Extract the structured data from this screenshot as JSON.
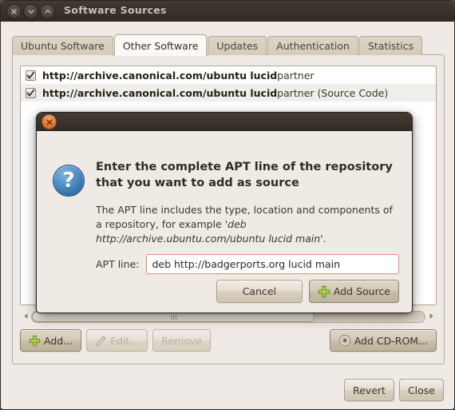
{
  "window": {
    "title": "Software Sources",
    "controls": [
      {
        "name": "close",
        "glyph": "×"
      },
      {
        "name": "minimize",
        "glyph": "∨"
      },
      {
        "name": "maximize",
        "glyph": "∧"
      }
    ]
  },
  "tabs": [
    {
      "label": "Ubuntu Software",
      "active": false
    },
    {
      "label": "Other Software",
      "active": true
    },
    {
      "label": "Updates",
      "active": false
    },
    {
      "label": "Authentication",
      "active": false
    },
    {
      "label": "Statistics",
      "active": false
    }
  ],
  "repositories": [
    {
      "checked": true,
      "url": "http://archive.canonical.com/ubuntu lucid",
      "components": " partner"
    },
    {
      "checked": true,
      "url": "http://archive.canonical.com/ubuntu lucid",
      "components": " partner (Source Code)"
    }
  ],
  "toolbar": {
    "add_label": "Add...",
    "edit_label": "Edit...",
    "remove_label": "Remove",
    "cdrom_label": "Add CD-ROM..."
  },
  "footer": {
    "revert_label": "Revert",
    "close_label": "Close"
  },
  "dialog": {
    "heading": "Enter the complete APT line of the repository that you want to add as source",
    "description_plain_1": "The APT line includes the type, location and components of a repository, for example ",
    "description_italic": "'deb http://archive.ubuntu.com/ubuntu lucid main'",
    "description_plain_2": ".",
    "apt_label": "APT line:",
    "apt_value": "deb http://badgerports.org lucid main",
    "cancel_label": "Cancel",
    "add_source_label": "Add Source"
  },
  "colors": {
    "titlebar": "#3a332b",
    "window_bg": "#efeae5",
    "tab_active_bg": "#fbf9f6",
    "tab_inactive_bg": "#d8cfbd",
    "focus_border": "#e08c78",
    "help_icon": "#3f7fb8",
    "close_icon": "#e07b34",
    "plus_icon": "#9ec84a"
  }
}
